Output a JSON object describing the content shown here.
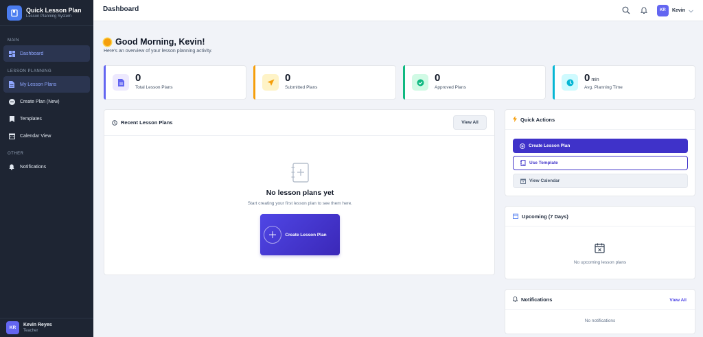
{
  "app": {
    "name": "Quick Lesson Plan",
    "tagline": "Lesson Planning System"
  },
  "sidebar": {
    "sections": {
      "main": "MAIN",
      "lesson_planning": "LESSON PLANNING",
      "other": "OTHER"
    },
    "items": [
      {
        "label": "Dashboard",
        "icon": "dashboard-icon",
        "active": true
      },
      {
        "label": "My Lesson Plans",
        "icon": "document-icon",
        "active": true
      },
      {
        "label": "Create Plan (New)",
        "icon": "plus-circle-icon",
        "active": false
      },
      {
        "label": "Templates",
        "icon": "bookmark-icon",
        "active": false
      },
      {
        "label": "Calendar View",
        "icon": "calendar-icon",
        "active": false
      },
      {
        "label": "Notifications",
        "icon": "bell-icon",
        "active": false
      }
    ],
    "user": {
      "initials": "KR",
      "name": "Kevin Reyes",
      "role": "Teacher"
    }
  },
  "header": {
    "title": "Dashboard",
    "user_initials": "KR",
    "user_name": "Kevin"
  },
  "welcome": {
    "title": "Good Morning, Kevin!",
    "subtitle": "Here's an overview of your lesson planning activity."
  },
  "stats": [
    {
      "value": "0",
      "unit": "",
      "label": "Total Lesson Plans",
      "color": "#6366f1",
      "bg": "#ede9fe",
      "icon": "document-icon"
    },
    {
      "value": "0",
      "unit": "",
      "label": "Submitted Plans",
      "color": "#f59e0b",
      "bg": "#fef3c7",
      "icon": "send-icon"
    },
    {
      "value": "0",
      "unit": "",
      "label": "Approved Plans",
      "color": "#10b981",
      "bg": "#d1fae5",
      "icon": "check-circle-icon"
    },
    {
      "value": "0",
      "unit": "min",
      "label": "Avg. Planning Time",
      "color": "#06b6d4",
      "bg": "#cffafe",
      "icon": "clock-icon"
    }
  ],
  "recent": {
    "title": "Recent Lesson Plans",
    "view_all": "View All",
    "empty_title": "No lesson plans yet",
    "empty_sub": "Start creating your first lesson plan to see them here.",
    "create_label": "Create Lesson Plan"
  },
  "quick_actions": {
    "title": "Quick Actions",
    "create": "Create Lesson Plan",
    "template": "Use Template",
    "calendar": "View Calendar"
  },
  "upcoming": {
    "title": "Upcoming (7 Days)",
    "empty": "No upcoming lesson plans"
  },
  "notifications": {
    "title": "Notifications",
    "view_all": "View All",
    "empty": "No notifications"
  }
}
